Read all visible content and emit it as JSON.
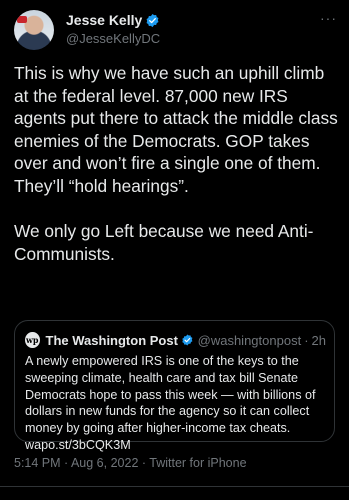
{
  "author": {
    "name": "Jesse Kelly",
    "handle": "@JesseKellyDC"
  },
  "more_label": "···",
  "tweet": {
    "text": "This is why we have such an uphill climb at the federal level. 87,000 new IRS agents put there to attack the middle class enemies of the Democrats. GOP takes over and won’t fire a single one of them. They’ll “hold hearings”.\n\nWe only go Left because we need Anti-Communists."
  },
  "quote": {
    "logo": "wp",
    "name": "The Washington Post",
    "handle": "@washingtonpost",
    "separator": "·",
    "time": "2h",
    "text": "A newly empowered IRS is one of the keys to the sweeping climate, health care and tax bill Senate Democrats hope to pass this week — with billions of dollars in new funds for the agency so it can collect money by going after higher-income tax cheats. wapo.st/3bCQK3M"
  },
  "meta": {
    "line": "5:14 PM · Aug 6, 2022 · Twitter for iPhone"
  },
  "colors": {
    "background": "#000000",
    "text": "#e7e9ea",
    "secondary": "#71767b",
    "verified": "#1d9bf0",
    "border": "#2f3336"
  },
  "icons": {
    "verified": "verified-badge-icon",
    "more": "more-horizontal-icon"
  }
}
